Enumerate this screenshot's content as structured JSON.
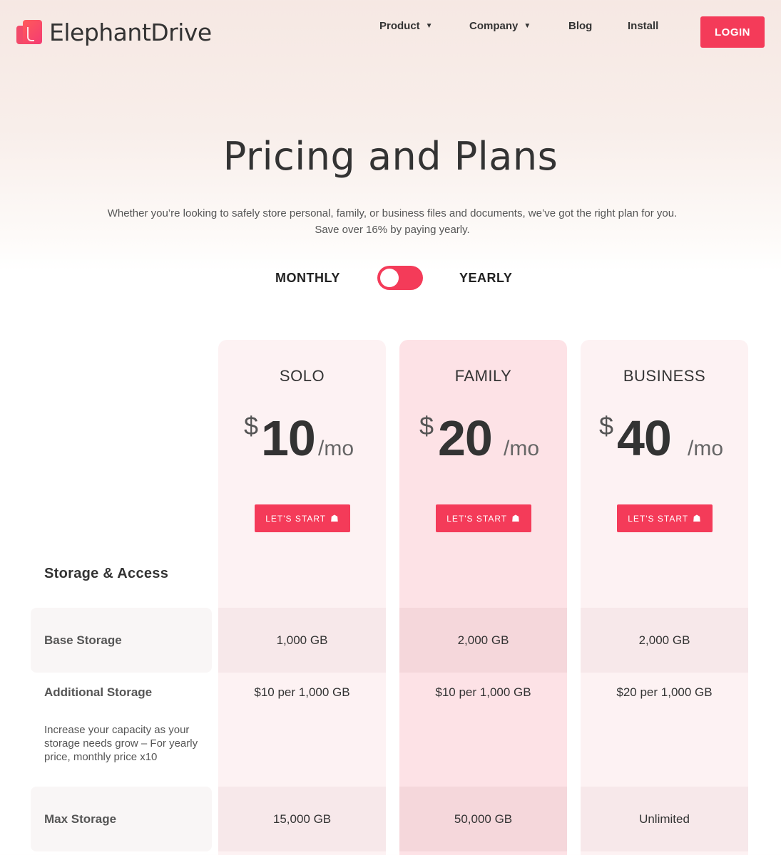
{
  "header": {
    "brand": "ElephantDrive",
    "nav": [
      {
        "label": "Product",
        "has_dropdown": true
      },
      {
        "label": "Company",
        "has_dropdown": true
      },
      {
        "label": "Blog",
        "has_dropdown": false
      },
      {
        "label": "Install",
        "has_dropdown": false
      }
    ],
    "caret": "▼",
    "login_label": "LOGIN"
  },
  "hero": {
    "title": "Pricing and Plans",
    "subtitle_line1": "Whether you’re looking to safely store personal, family, or business files and documents, we’ve got the right plan for you.",
    "subtitle_line2": "Save over 16% by paying yearly."
  },
  "billing_toggle": {
    "monthly_label": "MONTHLY",
    "yearly_label": "YEARLY",
    "selected": "monthly"
  },
  "plans": [
    {
      "name": "SOLO",
      "currency": "$",
      "amount": "10",
      "period": "/mo",
      "cta": "LET'S START"
    },
    {
      "name": "FAMILY",
      "currency": "$",
      "amount": "20",
      "period": "/mo",
      "cta": "LET'S START"
    },
    {
      "name": "BUSINESS",
      "currency": "$",
      "amount": "40",
      "period": "/mo",
      "cta": "LET'S START"
    }
  ],
  "features": {
    "section_title": "Storage & Access",
    "rows": [
      {
        "label": "Base Storage",
        "values": [
          "1,000 GB",
          "2,000 GB",
          "2,000 GB"
        ]
      },
      {
        "label": "Additional Storage",
        "description": "Increase your capacity as your storage needs grow – For yearly price, monthly price x10",
        "values": [
          "$10 per 1,000 GB",
          "$10 per 1,000 GB",
          "$20 per 1,000 GB"
        ]
      },
      {
        "label": "Max Storage",
        "values": [
          "15,000 GB",
          "50,000 GB",
          "Unlimited"
        ]
      }
    ]
  },
  "icons": {
    "home": "☗"
  },
  "colors": {
    "accent": "#f43b59",
    "family_column": "#fde2e6",
    "plan_column": "#fdf2f3"
  }
}
